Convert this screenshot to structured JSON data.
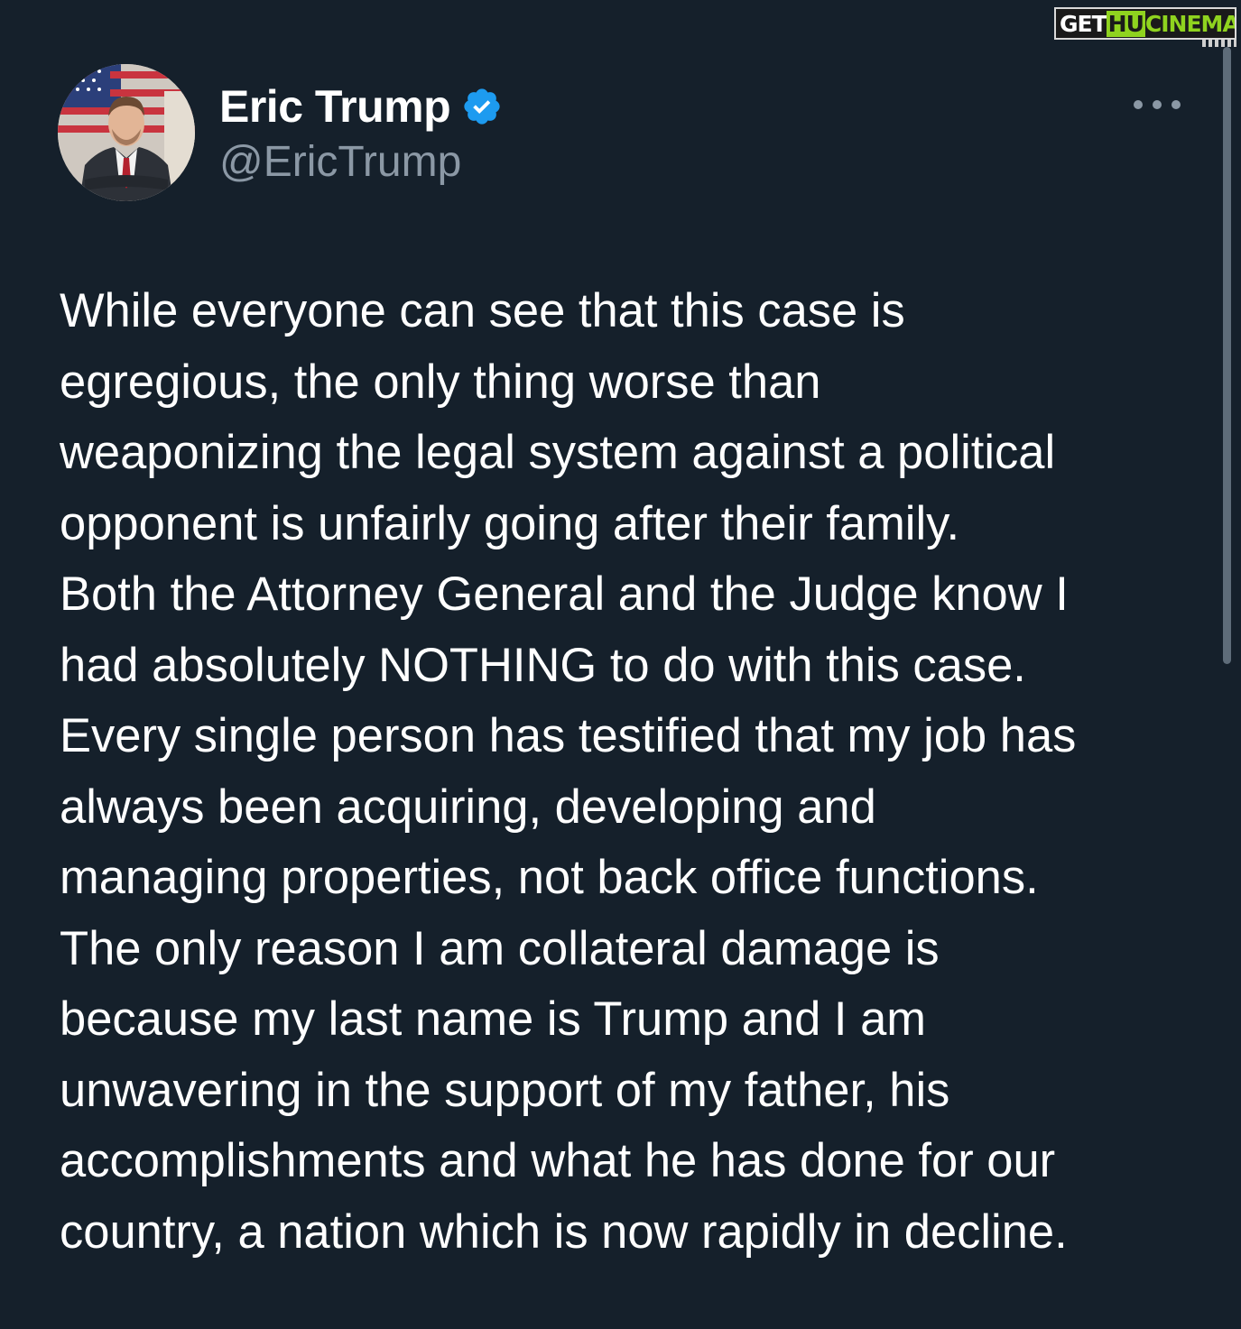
{
  "author": {
    "display_name": "Eric Trump",
    "handle": "@EricTrump",
    "verified": true,
    "verified_color": "#1d9bf0"
  },
  "tweet": {
    "lines": [
      "While everyone can see that this case is",
      "egregious, the only thing worse than",
      "weaponizing the legal system against a political",
      "opponent is unfairly going after their family.",
      "Both the Attorney General and the Judge know I",
      "had absolutely NOTHING to do with this case.",
      "Every single person has testified that my job has",
      "always been acquiring, developing and",
      "managing properties, not back office functions.",
      "The only reason I am collateral damage is",
      "because my last name is Trump and I am",
      "unwavering in the support of my father, his",
      "accomplishments and what he has done for our",
      "country, a nation which is now rapidly in decline."
    ]
  },
  "menu": {
    "icon": "more-horizontal-icon"
  },
  "watermark": {
    "part1": "GET",
    "part2": "HU",
    "part3": "CINEMA"
  },
  "colors": {
    "background": "#15202b",
    "text": "#ffffff",
    "secondary_text": "#8b98a5",
    "watermark_green": "#8fd31f"
  }
}
